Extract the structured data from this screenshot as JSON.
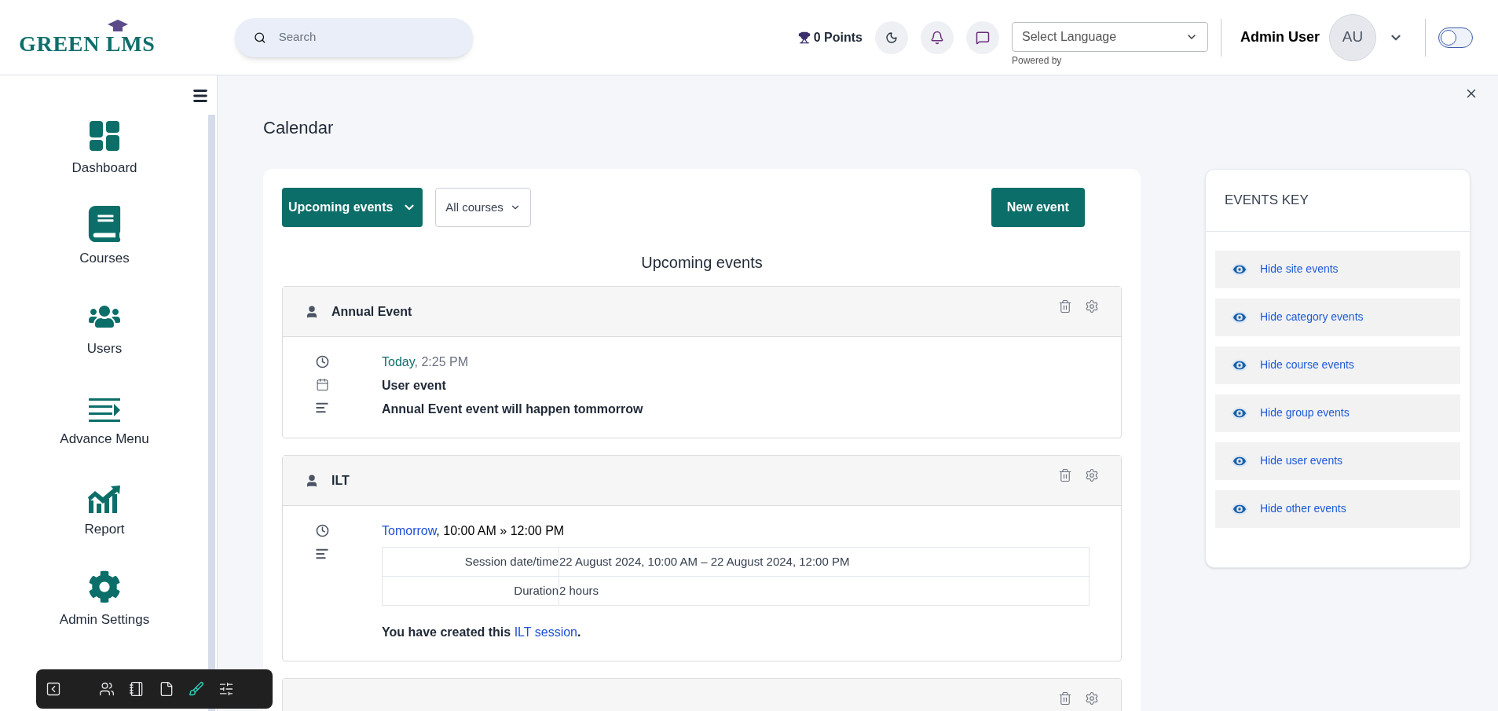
{
  "header": {
    "logo": "GREEN LMS",
    "search": {
      "placeholder": "Search"
    },
    "points": "0 Points",
    "language": {
      "placeholder": "Select Language"
    },
    "powered_by": "Powered by",
    "user_name": "Admin User",
    "avatar": "AU",
    "theme_toggle": {
      "on": false
    }
  },
  "sidebar": {
    "items": [
      {
        "kind": "dashboard",
        "label": "Dashboard"
      },
      {
        "kind": "courses",
        "label": "Courses"
      },
      {
        "kind": "users",
        "label": "Users"
      },
      {
        "kind": "menu",
        "label": "Advance Menu"
      },
      {
        "kind": "report",
        "label": "Report"
      },
      {
        "kind": "settings",
        "label": "Admin Settings"
      }
    ]
  },
  "page_title": "Calendar",
  "toolbar": {
    "view": "Upcoming events",
    "courses": "All courses",
    "new_event": "New event"
  },
  "section_title": "Upcoming events",
  "events": [
    {
      "kind": "user",
      "title": "Annual Event",
      "when_link": "Today",
      "when_rest": ", 2:25 PM",
      "type": "User event",
      "description": "Annual Event event will happen tommorrow"
    },
    {
      "kind": "ilt",
      "title": "ILT",
      "when_link": "Tomorrow",
      "when_rest": ", 10:00 AM » 12:00 PM",
      "details": [
        {
          "label": "Session date/time",
          "value": "22 August 2024, 10:00 AM – 22 August 2024, 12:00 PM"
        },
        {
          "label": "Duration",
          "value": "2 hours"
        }
      ],
      "note_prefix": "You have created this ",
      "note_link": "ILT session",
      "note_suffix": "."
    },
    {
      "kind": "partial"
    }
  ],
  "events_key": {
    "title": "EVENTS KEY",
    "items": [
      "Hide site events",
      "Hide category events",
      "Hide course events",
      "Hide group events",
      "Hide user events",
      "Hide other events"
    ]
  },
  "floating_toolbar": [
    {
      "kind": "back",
      "selected": false
    },
    {
      "kind": "users",
      "selected": false
    },
    {
      "kind": "notebook",
      "selected": false
    },
    {
      "kind": "file",
      "selected": false
    },
    {
      "kind": "brush",
      "selected": true
    },
    {
      "kind": "sliders",
      "selected": false
    }
  ]
}
